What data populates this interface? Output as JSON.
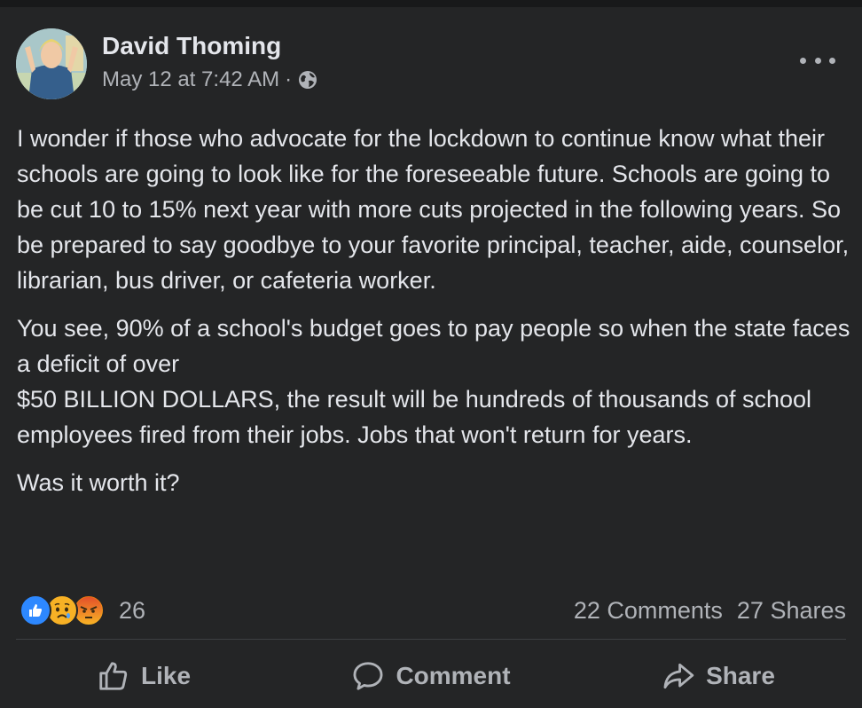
{
  "post": {
    "author": "David Thoming",
    "timestamp": "May 12 at 7:42 AM",
    "separator": "·",
    "privacy_icon": "globe-icon",
    "paragraphs": [
      "I wonder if those who advocate for the lockdown to continue know what their schools are going to look like for the foreseeable future. Schools are going to be cut 10 to 15% next year with more cuts projected in the following years.  So be prepared to say goodbye to your favorite principal, teacher, aide, counselor, librarian, bus driver, or cafeteria worker.",
      "You see, 90% of a school's budget goes to pay people so when the state faces a deficit of over\n$50 BILLION DOLLARS,  the result will be hundreds of thousands of school employees fired from their jobs.  Jobs that won't return for years.",
      "Was it worth it?"
    ]
  },
  "engagement": {
    "reaction_icons": [
      "like-reaction-icon",
      "sad-reaction-icon",
      "angry-reaction-icon"
    ],
    "reaction_count": "26",
    "comments": "22 Comments",
    "shares": "27 Shares"
  },
  "actions": {
    "like": "Like",
    "comment": "Comment",
    "share": "Share"
  },
  "colors": {
    "background": "#242526",
    "page": "#18191a",
    "text": "#e4e6eb",
    "secondary_text": "#b0b3b8",
    "like_blue": "#2d88ff"
  }
}
